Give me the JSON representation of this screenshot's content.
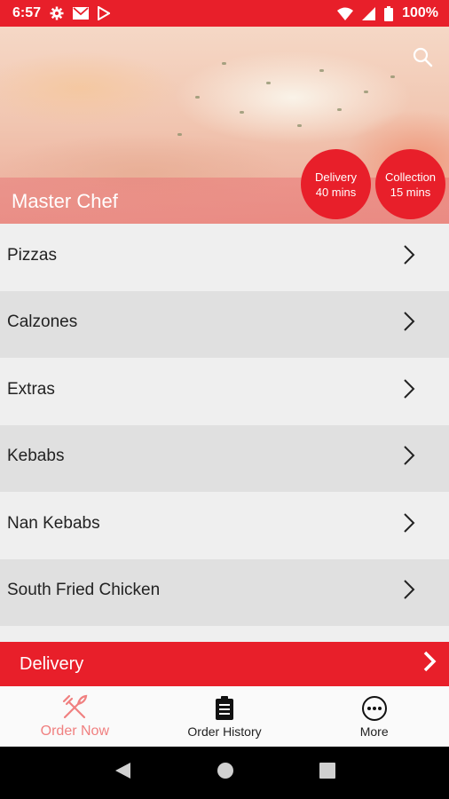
{
  "status_bar": {
    "time": "6:57",
    "icons_left": [
      "gear-icon",
      "gmail-icon",
      "play-store-icon"
    ],
    "icons_right": [
      "wifi-icon",
      "signal-icon",
      "battery-icon"
    ],
    "battery": "100%"
  },
  "header": {
    "restaurant_name": "Master Chef",
    "search_icon": "search-icon",
    "delivery_badge": {
      "line1": "Delivery",
      "line2": "40 mins"
    },
    "collection_badge": {
      "line1": "Collection",
      "line2": "15 mins"
    }
  },
  "categories": [
    {
      "label": "Pizzas"
    },
    {
      "label": "Calzones"
    },
    {
      "label": "Extras"
    },
    {
      "label": "Kebabs"
    },
    {
      "label": "Nan Kebabs"
    },
    {
      "label": "South Fried Chicken"
    }
  ],
  "delivery_bar": {
    "label": "Delivery"
  },
  "bottom_nav": [
    {
      "label": "Order Now",
      "icon": "fork-knife-icon",
      "active": true
    },
    {
      "label": "Order History",
      "icon": "clipboard-icon",
      "active": false
    },
    {
      "label": "More",
      "icon": "more-icon",
      "active": false
    }
  ],
  "colors": {
    "accent": "#e81f2a",
    "active_nav": "#f08080"
  }
}
